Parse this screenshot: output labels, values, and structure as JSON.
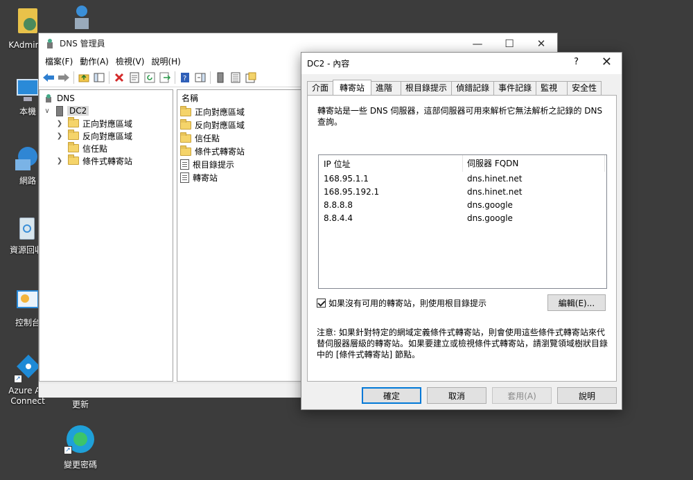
{
  "desktop": {
    "icons": [
      {
        "label": "KAdminis"
      },
      {
        "label": "本機"
      },
      {
        "label": "網路"
      },
      {
        "label": "資源回收"
      },
      {
        "label": "控制台"
      },
      {
        "label": "Azure AD Connect"
      },
      {
        "label": "更新"
      },
      {
        "label": "變更密碼"
      }
    ]
  },
  "mmc": {
    "title": "DNS 管理員",
    "menu": [
      "檔案(F)",
      "動作(A)",
      "檢視(V)",
      "說明(H)"
    ],
    "tree": {
      "root": "DNS",
      "server": "DC2",
      "children": [
        "正向對應區域",
        "反向對應區域",
        "信任點",
        "條件式轉寄站"
      ]
    },
    "list": {
      "header": "名稱",
      "items": [
        "正向對應區域",
        "反向對應區域",
        "信任點",
        "條件式轉寄站",
        "根目錄提示",
        "轉寄站"
      ]
    }
  },
  "dialog": {
    "title": "DC2 - 內容",
    "help": "?",
    "tabs": [
      "介面",
      "轉寄站",
      "進階",
      "根目錄提示",
      "偵錯記錄",
      "事件記錄",
      "監視",
      "安全性"
    ],
    "active_tab": "轉寄站",
    "description": "轉寄站是一些 DNS 伺服器，這部伺服器可用來解析它無法解析之記錄的 DNS 查詢。",
    "forwarders": {
      "columns": [
        "IP 位址",
        "伺服器 FQDN"
      ],
      "rows": [
        {
          "ip": "168.95.1.1",
          "fqdn": "dns.hinet.net"
        },
        {
          "ip": "168.95.192.1",
          "fqdn": "dns.hinet.net"
        },
        {
          "ip": "8.8.8.8",
          "fqdn": "dns.google"
        },
        {
          "ip": "8.8.4.4",
          "fqdn": "dns.google"
        }
      ]
    },
    "use_root_hints": {
      "label": "如果沒有可用的轉寄站，則使用根目錄提示",
      "checked": true
    },
    "edit_button": "編輯(E)...",
    "note": "注意: 如果針對特定的網域定義條件式轉寄站，則會使用這些條件式轉寄站來代替伺服器層級的轉寄站。如果要建立或檢視條件式轉寄站，請瀏覽領域樹狀目錄中的 [條件式轉寄站] 節點。",
    "buttons": {
      "ok": "確定",
      "cancel": "取消",
      "apply": "套用(A)",
      "help": "說明"
    }
  },
  "colors": {
    "desktop_bg": "#3c3c3c",
    "accent": "#0078d7",
    "folder": "#f5d46a"
  }
}
